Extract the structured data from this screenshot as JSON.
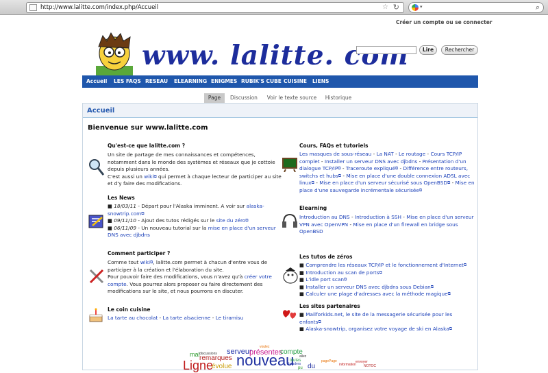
{
  "browser": {
    "url": "http://www.lalitte.com/index.php/Accueil"
  },
  "header": {
    "user_links": "Créer un compte ou se connecter",
    "site_name": "www. lalitte. com",
    "search_btn_read": "Lire",
    "search_btn_search": "Rechercher"
  },
  "nav": [
    "Accueil",
    "LES FAQS",
    "RESEAU",
    "ELEARNING",
    "ENIGMES",
    "RUBIK'S CUBE",
    "CUISINE",
    "LIENS"
  ],
  "tabs": [
    "Page",
    "Discussion",
    "Voir le texte source",
    "Historique"
  ],
  "page": {
    "title": "Accueil",
    "welcome": "Bienvenue sur www.lalitte.com"
  },
  "sections": {
    "about": {
      "title": "Qu'est-ce que lalitte.com ?",
      "p1": "Un site de partage de mes connaissances et compétences, notamment dans le monde des systèmes et réseaux que je cottoie depuis plusieurs années.",
      "p2_a": "C'est aussi un ",
      "p2_link": "wiki",
      "p2_b": " qui permet à chaque lecteur de participer au site et d'y faire des modifications."
    },
    "news": {
      "title": "Les News",
      "items": [
        {
          "date": "18/03/11",
          "text": " - Départ pour l'Alaska imminent. A voir sur ",
          "link": "alaska-snowtrip.com"
        },
        {
          "date": "09/11/10",
          "text": " - Ajout des tutos rédigés sur le ",
          "link": "site du zéro"
        },
        {
          "date": "06/11/09",
          "text": " - Un nouveau tutorial sur la ",
          "link": "mise en place d'un serveur DNS avec djbdns"
        }
      ]
    },
    "participate": {
      "title": "Comment participer ?",
      "a": "Comme tout ",
      "link1": "wiki",
      "b": ", lalitte.com permet à chacun d'entre vous de participer à la création et l'élaboration du site.",
      "c": "Pour pouvoir faire des modifications, vous n'avez qu'à ",
      "link2": "créer votre compte",
      "d": ". Vous pourrez alors proposer ou faire directement des modifications sur le site, et nous pourrons en discuter."
    },
    "cooking": {
      "title": "Le coin cuisine",
      "links": [
        "La tarte au chocolat",
        "La tarte alsacienne",
        "Le tiramisu"
      ]
    },
    "courses": {
      "title": "Cours, FAQs et tutoriels",
      "links": [
        "Les masques de sous-réseau",
        "La NAT",
        "Le routage",
        "Cours TCP/IP complet",
        "Installer un serveur DNS avec djbdns",
        "Présentation d'un dialogue TCP/IP",
        "Traceroute expliqué",
        "Différence entre routeurs, switchs et hubs",
        "Mise en place d'une double connexion ADSL avec linux",
        "Mise en place d'un serveur sécurisé sous OpenBSD",
        "Mise en place d'une sauvegarde incrémentale sécurisée"
      ]
    },
    "elearning": {
      "title": "Elearning",
      "links": [
        "Introduction au DNS",
        "Introduction à SSH",
        "Mise en place d'un serveur VPN avec OpenVPN",
        "Mise en place d'un firewall en bridge sous OpenBSD"
      ]
    },
    "zero": {
      "title": "Les tutos de zéros",
      "links": [
        "Comprendre les réseaux TCP/IP et le fonctionnement d'Internet",
        "Introduction au scan de ports",
        "L'idle port scan",
        "Installer un serveur DNS avec djbdns sous Debian",
        "Calculer une plage d'adresses avec la méthode magique"
      ]
    },
    "partners": {
      "title": "Les sites partenaires",
      "links": [
        "Mailforkids.net, le site de la messagerie sécurisée pour les enfants",
        "Alaska-snowtrip, organisez votre voyage de ski en Alaska"
      ]
    }
  },
  "tagcloud": [
    "voulez",
    "serveur",
    "présentes",
    "compte",
    "mal",
    "discussions",
    "remarques",
    "nouveau",
    "Ligne",
    "évolue",
    "allez",
    "toutes",
    "headers",
    "page",
    "pagePage",
    "information",
    "envoyer",
    "NOTOC",
    "du",
    "pu"
  ],
  "colors": {
    "nav": "#1f57ac",
    "link": "#1a3fb8",
    "title": "#2a5db0"
  }
}
